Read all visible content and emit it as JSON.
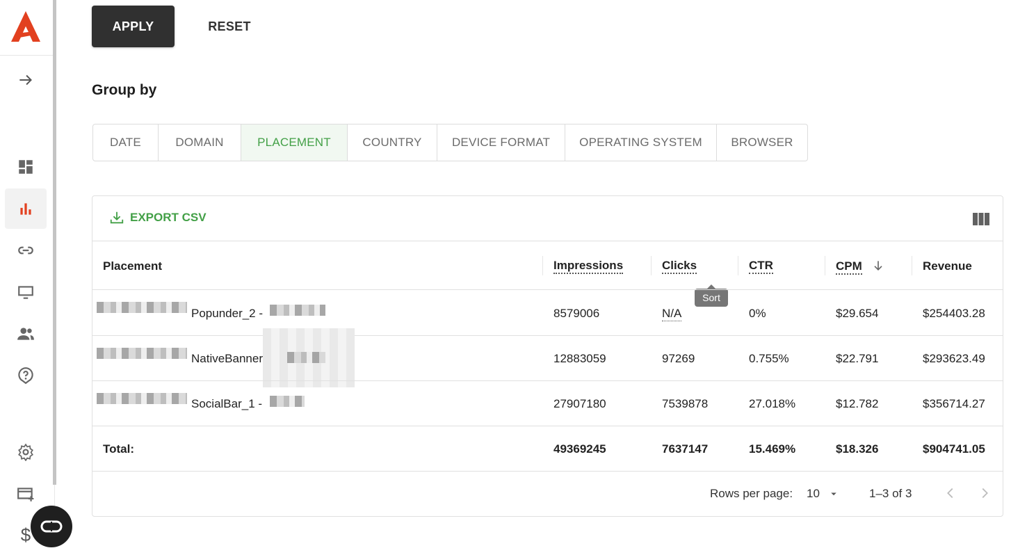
{
  "sidebar": {
    "icons": [
      "logo-icon",
      "expand-arrow-icon",
      "dashboard-icon",
      "statistics-icon",
      "link-icon",
      "monitor-icon",
      "users-icon",
      "help-icon",
      "settings-icon",
      "add-card-icon",
      "dollar-icon"
    ],
    "active": "statistics-icon",
    "accent_color": "#e2401f",
    "dollar_label": "$"
  },
  "actions": {
    "apply_label": "APPLY",
    "reset_label": "RESET"
  },
  "group_by": {
    "title": "Group by",
    "tabs": [
      {
        "label": "DATE"
      },
      {
        "label": "DOMAIN"
      },
      {
        "label": "PLACEMENT",
        "active": true
      },
      {
        "label": "COUNTRY"
      },
      {
        "label": "DEVICE FORMAT"
      },
      {
        "label": "OPERATING SYSTEM"
      },
      {
        "label": "BROWSER"
      }
    ],
    "active_color": "#43a047"
  },
  "table": {
    "export_label": "EXPORT CSV",
    "columns": [
      "Placement",
      "Impressions",
      "Clicks",
      "CTR",
      "CPM",
      "Revenue"
    ],
    "sorted_column": "CPM",
    "sort_direction": "descending",
    "tooltip": "Sort",
    "rows": [
      {
        "placement": "Popunder_2 -",
        "impressions": "8579006",
        "clicks": "N/A",
        "ctr": "0%",
        "cpm": "$29.654",
        "revenue": "$254403.28"
      },
      {
        "placement": "NativeBanner",
        "impressions": "12883059",
        "clicks": "97269",
        "ctr": "0.755%",
        "cpm": "$22.791",
        "revenue": "$293623.49"
      },
      {
        "placement": "SocialBar_1 -",
        "impressions": "27907180",
        "clicks": "7539878",
        "ctr": "27.018%",
        "cpm": "$12.782",
        "revenue": "$356714.27"
      }
    ],
    "total": {
      "label": "Total:",
      "impressions": "49369245",
      "clicks": "7637147",
      "ctr": "15.469%",
      "cpm": "$18.326",
      "revenue": "$904741.05"
    },
    "pagination": {
      "rows_per_page_label": "Rows per page:",
      "rows_per_page": "10",
      "range": "1–3 of 3"
    }
  }
}
